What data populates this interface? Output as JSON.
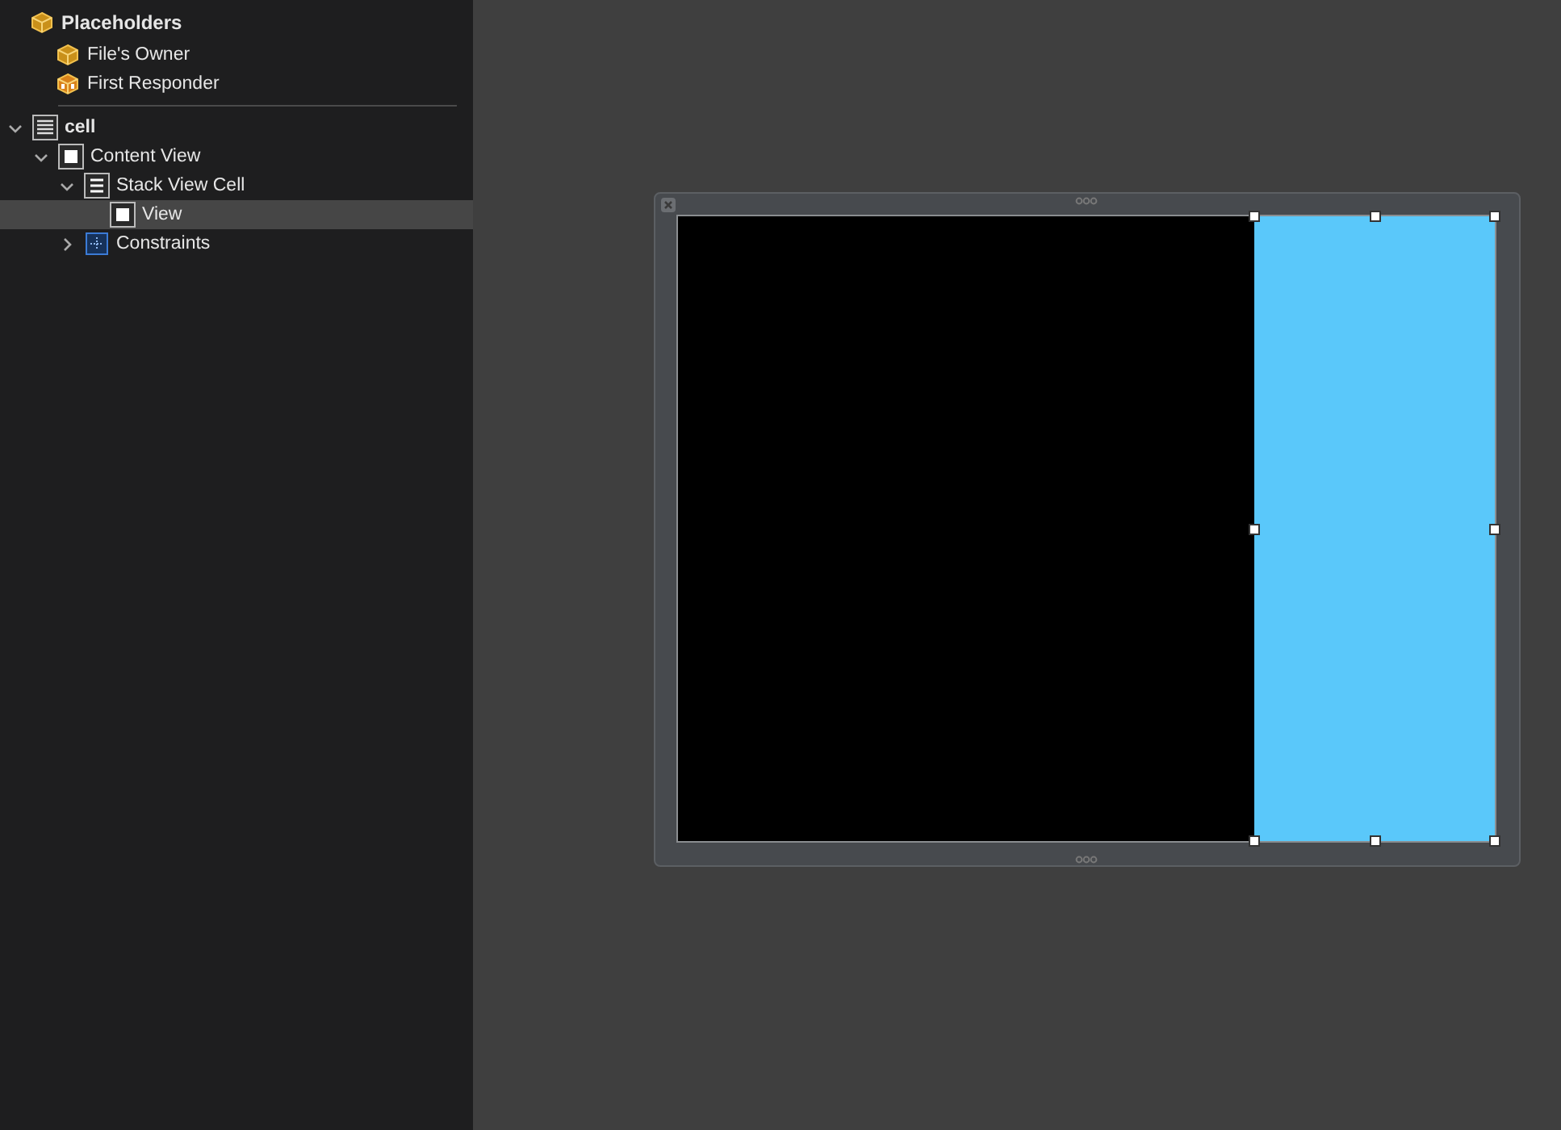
{
  "placeholders": {
    "title": "Placeholders",
    "kind": "cube",
    "items": [
      {
        "label": "File's Owner",
        "kind": "cube"
      },
      {
        "label": "First Responder",
        "kind": "responder"
      }
    ]
  },
  "outline": [
    {
      "label": "cell",
      "kind": "table",
      "expanded": true,
      "selected": false,
      "children": [
        {
          "label": "Content View",
          "kind": "view",
          "expanded": true,
          "selected": false,
          "children": [
            {
              "label": "Stack View Cell",
              "kind": "stack",
              "expanded": true,
              "selected": false,
              "children": [
                {
                  "label": "View",
                  "kind": "view",
                  "selected": true
                }
              ]
            },
            {
              "label": "Constraints",
              "kind": "constraints",
              "expanded": false,
              "selected": false
            }
          ]
        }
      ]
    }
  ],
  "canvas": {
    "views": [
      {
        "kind": "black",
        "selected": false
      },
      {
        "kind": "blue",
        "selected": true
      }
    ]
  }
}
